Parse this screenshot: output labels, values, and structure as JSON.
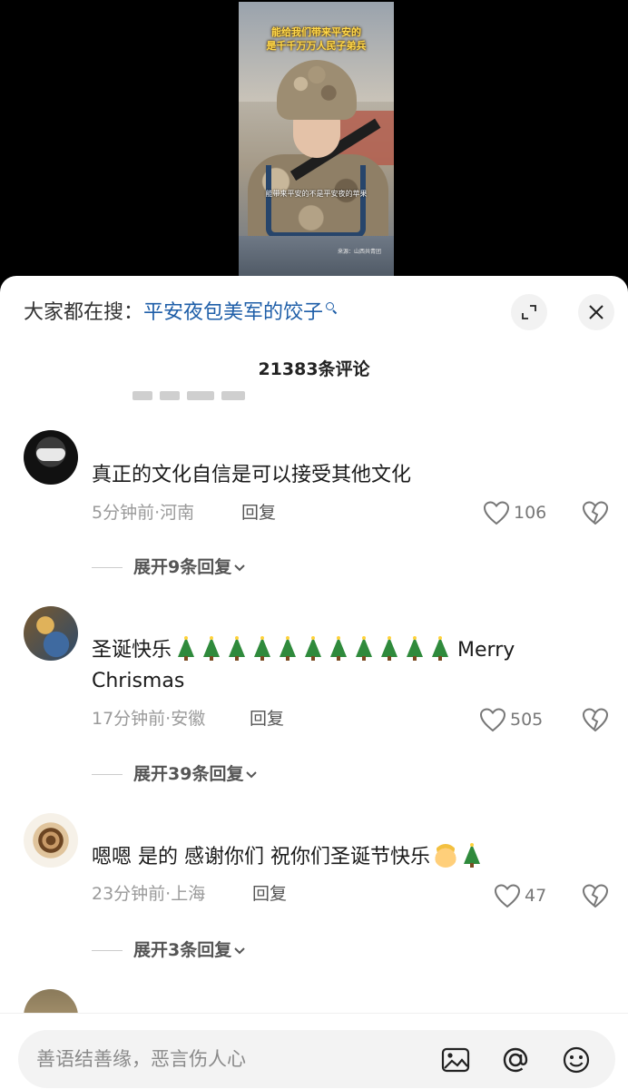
{
  "video": {
    "title_line1": "能给我们带来平安的",
    "title_line2": "是千千万万人民子弟兵",
    "caption": "能带来平安的不是平安夜的苹果",
    "source": "来源：山西共青团"
  },
  "search": {
    "prefix": "大家都在搜：",
    "term": "平安夜包美军的饺子"
  },
  "comment_count": "21383条评论",
  "comments": [
    {
      "text": "真正的文化自信是可以接受其他文化",
      "time_location": "5分钟前·河南",
      "reply_label": "回复",
      "likes": "106",
      "expand": "展开9条回复"
    },
    {
      "text": "圣诞快乐",
      "text_suffix": "Merry Chrismas",
      "tree_count": 11,
      "time_location": "17分钟前·安徽",
      "reply_label": "回复",
      "likes": "505",
      "expand": "展开39条回复"
    },
    {
      "text": "嗯嗯 是的 感谢你们 祝你们圣诞节快乐",
      "time_location": "23分钟前·上海",
      "reply_label": "回复",
      "likes": "47",
      "expand": "展开3条回复"
    }
  ],
  "input": {
    "placeholder": "善语结善缘，恶言伤人心"
  },
  "colors": {
    "link_blue": "#1e5ea8",
    "meta_gray": "#9a9a9a",
    "tree_green": "#2f8a3c"
  },
  "icons": [
    "search-icon",
    "expand-icon",
    "close-icon",
    "heart-icon",
    "broken-heart-icon",
    "chevron-down-icon",
    "image-icon",
    "at-icon",
    "emoji-icon"
  ]
}
